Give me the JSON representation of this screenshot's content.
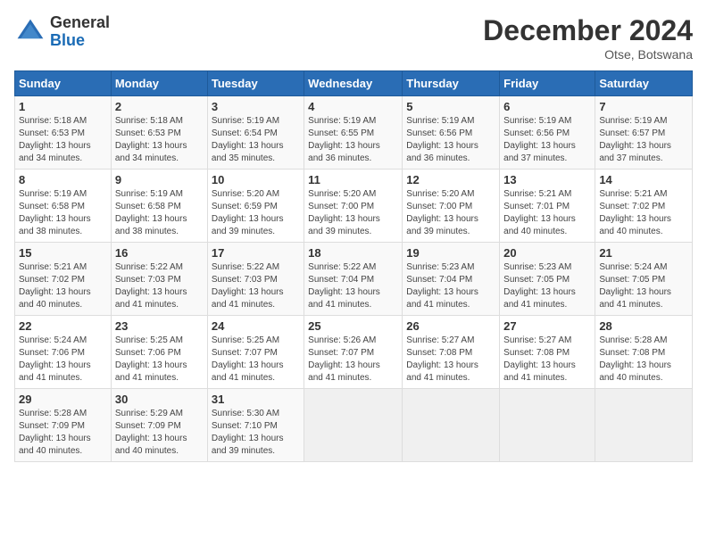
{
  "header": {
    "logo_general": "General",
    "logo_blue": "Blue",
    "month_title": "December 2024",
    "location": "Otse, Botswana"
  },
  "weekdays": [
    "Sunday",
    "Monday",
    "Tuesday",
    "Wednesday",
    "Thursday",
    "Friday",
    "Saturday"
  ],
  "weeks": [
    [
      {
        "day": "1",
        "info": "Sunrise: 5:18 AM\nSunset: 6:53 PM\nDaylight: 13 hours\nand 34 minutes."
      },
      {
        "day": "2",
        "info": "Sunrise: 5:18 AM\nSunset: 6:53 PM\nDaylight: 13 hours\nand 34 minutes."
      },
      {
        "day": "3",
        "info": "Sunrise: 5:19 AM\nSunset: 6:54 PM\nDaylight: 13 hours\nand 35 minutes."
      },
      {
        "day": "4",
        "info": "Sunrise: 5:19 AM\nSunset: 6:55 PM\nDaylight: 13 hours\nand 36 minutes."
      },
      {
        "day": "5",
        "info": "Sunrise: 5:19 AM\nSunset: 6:56 PM\nDaylight: 13 hours\nand 36 minutes."
      },
      {
        "day": "6",
        "info": "Sunrise: 5:19 AM\nSunset: 6:56 PM\nDaylight: 13 hours\nand 37 minutes."
      },
      {
        "day": "7",
        "info": "Sunrise: 5:19 AM\nSunset: 6:57 PM\nDaylight: 13 hours\nand 37 minutes."
      }
    ],
    [
      {
        "day": "8",
        "info": "Sunrise: 5:19 AM\nSunset: 6:58 PM\nDaylight: 13 hours\nand 38 minutes."
      },
      {
        "day": "9",
        "info": "Sunrise: 5:19 AM\nSunset: 6:58 PM\nDaylight: 13 hours\nand 38 minutes."
      },
      {
        "day": "10",
        "info": "Sunrise: 5:20 AM\nSunset: 6:59 PM\nDaylight: 13 hours\nand 39 minutes."
      },
      {
        "day": "11",
        "info": "Sunrise: 5:20 AM\nSunset: 7:00 PM\nDaylight: 13 hours\nand 39 minutes."
      },
      {
        "day": "12",
        "info": "Sunrise: 5:20 AM\nSunset: 7:00 PM\nDaylight: 13 hours\nand 39 minutes."
      },
      {
        "day": "13",
        "info": "Sunrise: 5:21 AM\nSunset: 7:01 PM\nDaylight: 13 hours\nand 40 minutes."
      },
      {
        "day": "14",
        "info": "Sunrise: 5:21 AM\nSunset: 7:02 PM\nDaylight: 13 hours\nand 40 minutes."
      }
    ],
    [
      {
        "day": "15",
        "info": "Sunrise: 5:21 AM\nSunset: 7:02 PM\nDaylight: 13 hours\nand 40 minutes."
      },
      {
        "day": "16",
        "info": "Sunrise: 5:22 AM\nSunset: 7:03 PM\nDaylight: 13 hours\nand 41 minutes."
      },
      {
        "day": "17",
        "info": "Sunrise: 5:22 AM\nSunset: 7:03 PM\nDaylight: 13 hours\nand 41 minutes."
      },
      {
        "day": "18",
        "info": "Sunrise: 5:22 AM\nSunset: 7:04 PM\nDaylight: 13 hours\nand 41 minutes."
      },
      {
        "day": "19",
        "info": "Sunrise: 5:23 AM\nSunset: 7:04 PM\nDaylight: 13 hours\nand 41 minutes."
      },
      {
        "day": "20",
        "info": "Sunrise: 5:23 AM\nSunset: 7:05 PM\nDaylight: 13 hours\nand 41 minutes."
      },
      {
        "day": "21",
        "info": "Sunrise: 5:24 AM\nSunset: 7:05 PM\nDaylight: 13 hours\nand 41 minutes."
      }
    ],
    [
      {
        "day": "22",
        "info": "Sunrise: 5:24 AM\nSunset: 7:06 PM\nDaylight: 13 hours\nand 41 minutes."
      },
      {
        "day": "23",
        "info": "Sunrise: 5:25 AM\nSunset: 7:06 PM\nDaylight: 13 hours\nand 41 minutes."
      },
      {
        "day": "24",
        "info": "Sunrise: 5:25 AM\nSunset: 7:07 PM\nDaylight: 13 hours\nand 41 minutes."
      },
      {
        "day": "25",
        "info": "Sunrise: 5:26 AM\nSunset: 7:07 PM\nDaylight: 13 hours\nand 41 minutes."
      },
      {
        "day": "26",
        "info": "Sunrise: 5:27 AM\nSunset: 7:08 PM\nDaylight: 13 hours\nand 41 minutes."
      },
      {
        "day": "27",
        "info": "Sunrise: 5:27 AM\nSunset: 7:08 PM\nDaylight: 13 hours\nand 41 minutes."
      },
      {
        "day": "28",
        "info": "Sunrise: 5:28 AM\nSunset: 7:08 PM\nDaylight: 13 hours\nand 40 minutes."
      }
    ],
    [
      {
        "day": "29",
        "info": "Sunrise: 5:28 AM\nSunset: 7:09 PM\nDaylight: 13 hours\nand 40 minutes."
      },
      {
        "day": "30",
        "info": "Sunrise: 5:29 AM\nSunset: 7:09 PM\nDaylight: 13 hours\nand 40 minutes."
      },
      {
        "day": "31",
        "info": "Sunrise: 5:30 AM\nSunset: 7:10 PM\nDaylight: 13 hours\nand 39 minutes."
      },
      {
        "day": "",
        "info": ""
      },
      {
        "day": "",
        "info": ""
      },
      {
        "day": "",
        "info": ""
      },
      {
        "day": "",
        "info": ""
      }
    ]
  ]
}
